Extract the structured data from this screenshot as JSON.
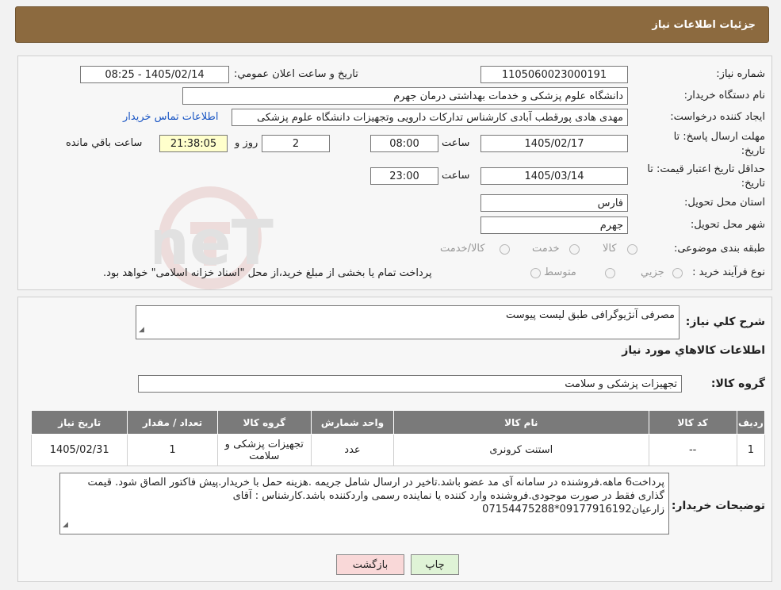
{
  "header": {
    "title": "جزئیات اطلاعات نیاز"
  },
  "form": {
    "need_number_label": "شماره نیاز:",
    "need_number": "1105060023000191",
    "announce_label": "تاریخ و ساعت اعلان عمومي:",
    "announce_value": "1405/02/14 - 08:25",
    "buyer_org_label": "نام دستگاه خريدار:",
    "buyer_org": "دانشگاه علوم پزشکی و خدمات بهداشتی  درمان جهرم",
    "requester_label": "ايجاد کننده درخواست:",
    "requester": "مهدی هادی پورقطب آبادی کارشناس تدارکات دارویی وتجهیزات دانشگاه علوم پزشکی",
    "contact_link": "اطلاعات تماس خريدار",
    "deadline_label_1": "مهلت ارسال پاسخ: تا",
    "deadline_label_2": "تاريخ:",
    "deadline_date": "1405/02/17",
    "time_label": "ساعت",
    "deadline_time": "08:00",
    "days_value": "2",
    "days_label": "روز و",
    "remaining_time": "21:38:05",
    "remaining_label": "ساعت باقي مانده",
    "validity_label_1": "حداقل تاريخ اعتبار قيمت: تا",
    "validity_label_2": "تاريخ:",
    "validity_date": "1405/03/14",
    "validity_time": "23:00",
    "province_label": "استان محل تحويل:",
    "province": "فارس",
    "city_label": "شهر محل تحويل:",
    "city": "جهرم",
    "category_label": "طبقه بندی موضوعی:",
    "category_options": [
      "کالا",
      "خدمت",
      "کالا/خدمت"
    ],
    "process_label": "نوع فرآيند خريد :",
    "process_options": [
      "جزيي",
      "متوسط"
    ],
    "process_note": "پرداخت تمام يا بخشی از مبلغ خريد،از محل \"اسناد خزانه اسلامی\" خواهد بود."
  },
  "summary": {
    "description_label": "شرح کلي نياز:",
    "description": "مصرفی آنژیوگرافی طبق لیست پیوست",
    "goods_info_title": "اطلاعات کالاهاي مورد نياز",
    "goods_group_label": "گروه کالا:",
    "goods_group": "تجهیزات پزشکی و سلامت"
  },
  "table": {
    "headers": [
      "رديف",
      "کد کالا",
      "نام کالا",
      "واحد شمارش",
      "گروه کالا",
      "تعداد / مقدار",
      "تاريخ نياز"
    ],
    "rows": [
      [
        "1",
        "--",
        "استنت کرونری",
        "عدد",
        "تجهیزات پزشکی و سلامت",
        "1",
        "1405/02/31"
      ]
    ]
  },
  "notes": {
    "label": "توضيحات خريدار:",
    "text": "پرداخت6 ماهه.فروشنده در سامانه آی مد عضو باشد.تاخیر در ارسال شامل جریمه .هزینه حمل با خریدار.پیش فاکتور الصاق شود. قیمت گذاری فقط در صورت موجودی.فروشنده وارد کننده یا نماینده رسمی واردکننده باشد.کارشناس : آقای زارعیان09177916192*07154475288"
  },
  "buttons": {
    "print": "چاپ",
    "back": "بازگشت"
  },
  "watermark": {
    "text": "AriaTender.neT"
  },
  "colors": {
    "header": "#8c6a3f",
    "link": "#1a56c4",
    "table_header": "#7a7a7a",
    "back_button": "#f9d8d8",
    "print_button": "#dff3d6"
  }
}
